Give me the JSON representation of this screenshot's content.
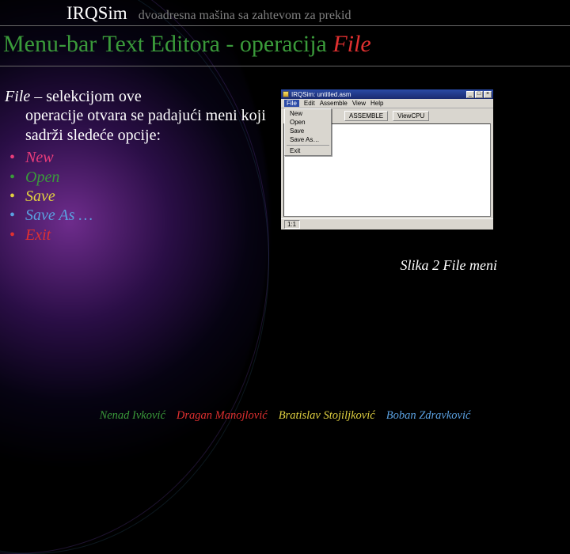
{
  "header": {
    "brand": "IRQSim",
    "subtitle": "dvoadresna mašina sa zahtevom za prekid"
  },
  "title": {
    "part1": "Menu-bar Text Editora - operacija ",
    "part2": "File"
  },
  "intro": {
    "keyword": "File",
    "rest_first": " – selekcijom ove",
    "rest_body": "operacije otvara se padajući meni koji sadrži sledeće opcije:"
  },
  "options": {
    "new": "New",
    "open": "Open",
    "save": "Save",
    "saveas": "Save As …",
    "exit": "Exit"
  },
  "caption": "Slika 2 File meni",
  "app": {
    "title": "IRQSim: untitled.asm",
    "menubar": {
      "file": "File",
      "edit": "Edit",
      "assemble": "Assemble",
      "view": "View",
      "help": "Help"
    },
    "toolbar": {
      "assemble": "ASSEMBLE",
      "viewcpu": "ViewCPU"
    },
    "dropdown": {
      "new": "New",
      "open": "Open",
      "save": "Save",
      "saveas": "Save As…",
      "exit": "Exit"
    },
    "status": "1:1",
    "winbtns": {
      "min": "_",
      "max": "□",
      "close": "×"
    }
  },
  "footer": {
    "a1": "Nenad Ivković",
    "a2": "Dragan Manojlović",
    "a3": "Bratislav Stojiljković",
    "a4": "Boban Zdravković"
  }
}
